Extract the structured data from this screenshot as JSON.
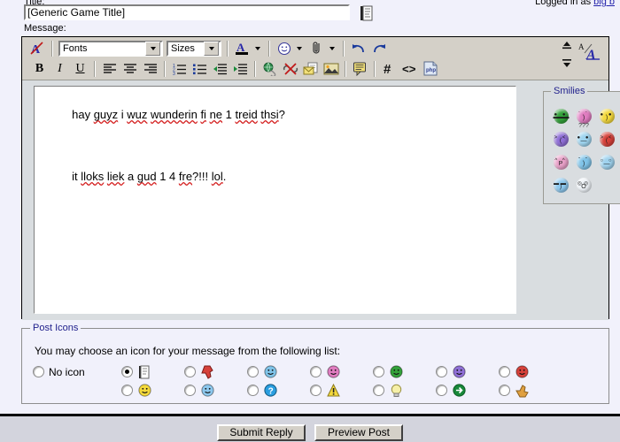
{
  "header": {
    "title_label": "Title:",
    "logged_in_prefix": "Logged in as",
    "logged_in_user": "big b"
  },
  "title_field": {
    "value": "[Generic Game Title]",
    "placeholder": "",
    "icon": "document-icon"
  },
  "message": {
    "label": "Message:",
    "lines": [
      "hay guyz i wuz wunderin fi ne 1 treid thsi?",
      "it lloks liek a gud 1 4 fre?!!! lol."
    ]
  },
  "toolbar": {
    "row1": [
      {
        "name": "remove-formatting-icon",
        "label": "A",
        "type": "icon"
      },
      {
        "name": "font-family-select",
        "label": "Fonts",
        "type": "combo"
      },
      {
        "name": "font-size-select",
        "label": "Sizes",
        "type": "combo"
      },
      {
        "name": "font-color-icon",
        "label": "A",
        "type": "icon-split"
      },
      {
        "name": "smiley-icon",
        "label": "☺",
        "type": "icon-split"
      },
      {
        "name": "attachment-icon",
        "label": "✂",
        "type": "icon-split"
      },
      {
        "name": "undo-icon",
        "label": "↶",
        "type": "icon"
      },
      {
        "name": "redo-icon",
        "label": "↷",
        "type": "icon"
      }
    ],
    "row2": [
      {
        "name": "bold-icon",
        "label": "B"
      },
      {
        "name": "italic-icon",
        "label": "I"
      },
      {
        "name": "underline-icon",
        "label": "U"
      },
      {
        "name": "align-left-icon",
        "label": "align-left"
      },
      {
        "name": "align-center-icon",
        "label": "align-center"
      },
      {
        "name": "align-right-icon",
        "label": "align-right"
      },
      {
        "name": "ordered-list-icon",
        "label": "ordered-list"
      },
      {
        "name": "unordered-list-icon",
        "label": "unordered-list"
      },
      {
        "name": "outdent-icon",
        "label": "outdent"
      },
      {
        "name": "indent-icon",
        "label": "indent"
      },
      {
        "name": "insert-link-icon",
        "label": "globe"
      },
      {
        "name": "remove-link-icon",
        "label": "broken-link"
      },
      {
        "name": "insert-email-icon",
        "label": "email"
      },
      {
        "name": "insert-image-icon",
        "label": "image"
      },
      {
        "name": "insert-quote-icon",
        "label": "quote"
      },
      {
        "name": "insert-hash-icon",
        "label": "#"
      },
      {
        "name": "insert-code-icon",
        "label": "<>"
      },
      {
        "name": "insert-php-icon",
        "label": "php"
      }
    ],
    "right": {
      "collapse_expand": "collapse-expand-icon",
      "toggle_wysiwyg": "toggle-wysiwyg-icon"
    },
    "fonts_value": "Fonts",
    "sizes_value": "Sizes"
  },
  "smilies": {
    "legend": "Smilies",
    "items": [
      {
        "name": "smiley-grin",
        "color": "#33a13a",
        "eyes": "● ●",
        "mouth": "grin"
      },
      {
        "name": "smiley-blush",
        "color": "#e07cc0",
        "eyes": "´ `",
        "mouth": ")"
      },
      {
        "name": "smiley-happy",
        "color": "#f4d93c",
        "eyes": "● ●",
        "mouth": ")"
      },
      {
        "name": "smiley-mad",
        "color": "#8f6fd6",
        "eyes": ">  <",
        "mouth": "("
      },
      {
        "name": "smiley-confused",
        "color": "#9ed4ef",
        "eyes": "● ●",
        "mouth": "—",
        "extra": "???"
      },
      {
        "name": "smiley-angry",
        "color": "#d6413a",
        "eyes": "> <",
        "mouth": "("
      },
      {
        "name": "smiley-tongue",
        "color": "#e8a0c8",
        "eyes": "^ ^",
        "mouth": "P"
      },
      {
        "name": "smiley-wink",
        "color": "#7fc3e8",
        "eyes": "ˇ ˇ",
        "mouth": ")"
      },
      {
        "name": "smiley-roll-eyes",
        "color": "#9fd2ee",
        "eyes": "○ ○",
        "mouth": "—"
      },
      {
        "name": "smiley-cool",
        "color": "#8dc8ee",
        "eyes": "▬▬",
        "mouth": ")"
      },
      {
        "name": "smiley-shocked",
        "color": "#eef3f8",
        "eyes": "◎◎",
        "mouth": "O"
      }
    ]
  },
  "post_icons": {
    "legend": "Post Icons",
    "description": "You may choose an icon for your message from the following list:",
    "no_icon_label": "No icon",
    "selected": "icon-document",
    "columns": [
      {
        "items": [
          {
            "name": "icon-document",
            "glyph": "document",
            "color": "#e8e8e8",
            "selected": true
          },
          {
            "name": "icon-smile",
            "glyph": "smile",
            "color": "#f4d93c",
            "selected": false
          }
        ]
      },
      {
        "items": [
          {
            "name": "icon-thumbs-down",
            "glyph": "thumbsdown",
            "color": "#d6413a",
            "selected": false
          },
          {
            "name": "icon-cool",
            "glyph": "cool",
            "color": "#8dc8ee",
            "selected": false
          }
        ]
      },
      {
        "items": [
          {
            "name": "icon-wink",
            "glyph": "wink",
            "color": "#7fc3e8",
            "selected": false
          },
          {
            "name": "icon-question",
            "glyph": "question",
            "color": "#2a9ee0",
            "selected": false
          }
        ]
      },
      {
        "items": [
          {
            "name": "icon-blush",
            "glyph": "blush",
            "color": "#e07cc0",
            "selected": false
          },
          {
            "name": "icon-warning",
            "glyph": "warning",
            "color": "#f4d93c",
            "selected": false
          }
        ]
      },
      {
        "items": [
          {
            "name": "icon-grin",
            "glyph": "grin",
            "color": "#33a13a",
            "selected": false
          },
          {
            "name": "icon-lightbulb",
            "glyph": "bulb",
            "color": "#f6f0a8",
            "selected": false
          }
        ]
      },
      {
        "items": [
          {
            "name": "icon-mad",
            "glyph": "mad",
            "color": "#8f6fd6",
            "selected": false
          },
          {
            "name": "icon-arrow",
            "glyph": "arrow",
            "color": "#18883a",
            "selected": false
          }
        ]
      },
      {
        "items": [
          {
            "name": "icon-angry",
            "glyph": "angry",
            "color": "#d6413a",
            "selected": false
          },
          {
            "name": "icon-thumbs-up",
            "glyph": "thumbsup",
            "color": "#e0a040",
            "selected": false
          }
        ]
      }
    ]
  },
  "footer": {
    "submit_label": "Submit Reply",
    "preview_label": "Preview Post"
  },
  "colors": {
    "page_bg": "#f1f1fb",
    "toolbar_bg": "#d4d0c8",
    "editor_bg": "#d9dde0",
    "legend_text": "#21218c",
    "link": "#2222aa",
    "footer_bg": "#d3d4dd"
  }
}
